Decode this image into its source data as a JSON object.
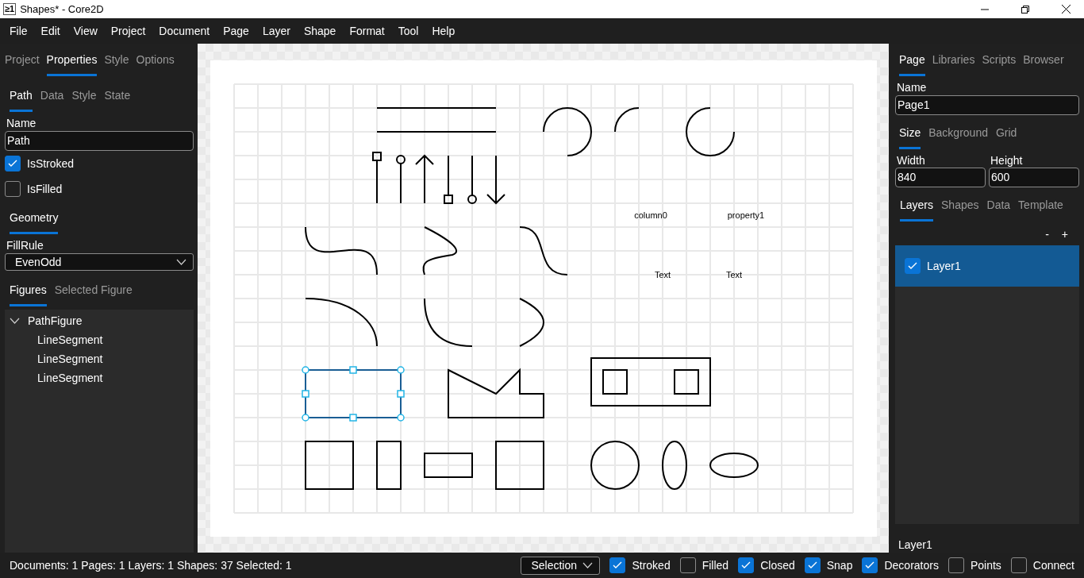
{
  "window": {
    "title": "Shapes* - Core2D",
    "app_mark": "≥1"
  },
  "menu": [
    "File",
    "Edit",
    "View",
    "Project",
    "Document",
    "Page",
    "Layer",
    "Shape",
    "Format",
    "Tool",
    "Help"
  ],
  "left_panel": {
    "tabs": [
      {
        "label": "Project",
        "selected": false
      },
      {
        "label": "Properties",
        "selected": true
      },
      {
        "label": "Style",
        "selected": false
      },
      {
        "label": "Options",
        "selected": false
      }
    ],
    "sub_tabs": [
      {
        "label": "Path",
        "selected": true
      },
      {
        "label": "Data",
        "selected": false
      },
      {
        "label": "Style",
        "selected": false
      },
      {
        "label": "State",
        "selected": false
      }
    ],
    "name_label": "Name",
    "name_value": "Path",
    "checkboxes": [
      {
        "label": "IsStroked",
        "checked": true
      },
      {
        "label": "IsFilled",
        "checked": false
      }
    ],
    "geometry_tabs": [
      {
        "label": "Geometry",
        "selected": true
      }
    ],
    "fill_rule_label": "FillRule",
    "fill_rule_value": "EvenOdd",
    "figure_tabs": [
      {
        "label": "Figures",
        "selected": true
      },
      {
        "label": "Selected Figure",
        "selected": false
      }
    ],
    "tree": [
      {
        "label": "PathFigure",
        "expanded": true,
        "children": [
          {
            "label": "LineSegment"
          },
          {
            "label": "LineSegment"
          },
          {
            "label": "LineSegment"
          }
        ]
      }
    ]
  },
  "canvas_texts": [
    {
      "text": "column0"
    },
    {
      "text": "property1"
    },
    {
      "text": "Text"
    },
    {
      "text": "Text"
    }
  ],
  "right_panel": {
    "tabs": [
      {
        "label": "Page",
        "selected": true
      },
      {
        "label": "Libraries",
        "selected": false
      },
      {
        "label": "Scripts",
        "selected": false
      },
      {
        "label": "Browser",
        "selected": false
      }
    ],
    "name_label": "Name",
    "name_value": "Page1",
    "size_tabs": [
      {
        "label": "Size",
        "selected": true
      },
      {
        "label": "Background",
        "selected": false
      },
      {
        "label": "Grid",
        "selected": false
      }
    ],
    "fields": [
      {
        "label": "Width",
        "value": "840"
      },
      {
        "label": "Height",
        "value": "600"
      }
    ],
    "layer_tabs": [
      {
        "label": "Layers",
        "selected": true
      },
      {
        "label": "Shapes",
        "selected": false
      },
      {
        "label": "Data",
        "selected": false
      },
      {
        "label": "Template",
        "selected": false
      }
    ],
    "layer_buttons": [
      "-",
      "+"
    ],
    "layers": [
      {
        "name": "Layer1",
        "checked": true,
        "selected": true
      }
    ],
    "current_layer": "Layer1"
  },
  "status_bar": {
    "text": "Documents: 1 Pages: 1 Layers: 1 Shapes: 37 Selected: 1",
    "tool": "Selection",
    "toggles": [
      {
        "label": "Stroked",
        "checked": true
      },
      {
        "label": "Filled",
        "checked": false
      },
      {
        "label": "Closed",
        "checked": true
      },
      {
        "label": "Snap",
        "checked": true
      },
      {
        "label": "Decorators",
        "checked": true
      },
      {
        "label": "Points",
        "checked": false
      },
      {
        "label": "Connect",
        "checked": false
      }
    ]
  }
}
